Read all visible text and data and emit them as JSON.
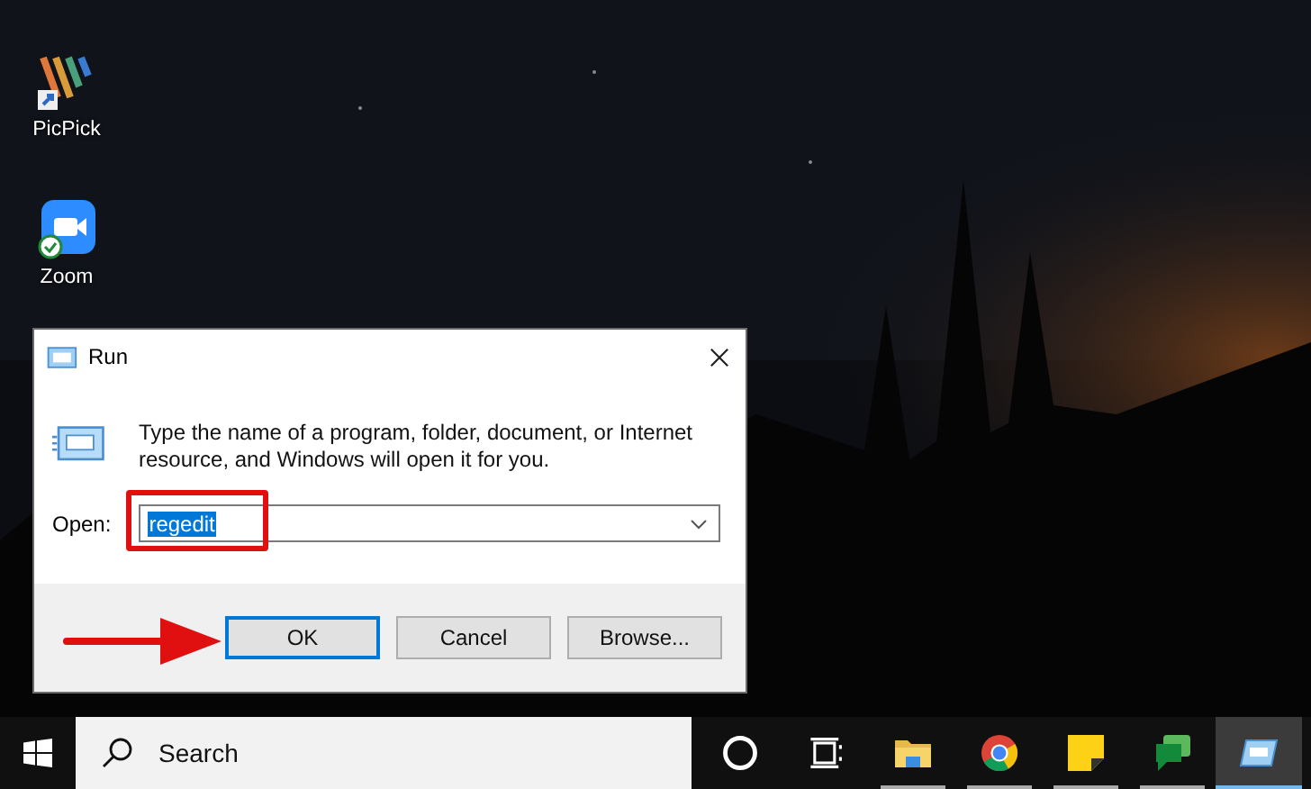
{
  "desktop": {
    "icons": [
      {
        "label": "PicPick",
        "kind": "picpick"
      },
      {
        "label": "Zoom",
        "kind": "zoom"
      }
    ]
  },
  "dialog": {
    "title": "Run",
    "message": "Type the name of a program, folder, document, or Internet resource, and Windows will open it for you.",
    "open_label": "Open:",
    "open_value": "regedit",
    "buttons": [
      {
        "label": "OK",
        "default": true
      },
      {
        "label": "Cancel",
        "default": false
      },
      {
        "label": "Browse...",
        "default": false
      }
    ]
  },
  "taskbar": {
    "search_placeholder": "Search",
    "apps": [
      {
        "kind": "cortana",
        "running": false,
        "selected": false
      },
      {
        "kind": "taskview",
        "running": false,
        "selected": false
      },
      {
        "kind": "explorer",
        "running": true,
        "selected": false
      },
      {
        "kind": "chrome",
        "running": true,
        "selected": false
      },
      {
        "kind": "notes",
        "running": true,
        "selected": false
      },
      {
        "kind": "chat",
        "running": true,
        "selected": false
      },
      {
        "kind": "run",
        "running": true,
        "selected": true
      }
    ]
  }
}
